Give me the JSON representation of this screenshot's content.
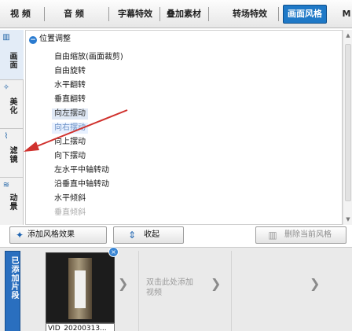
{
  "tabs": [
    {
      "label": "视 频"
    },
    {
      "label": "音 频"
    },
    {
      "label": "字幕特效"
    },
    {
      "label": "叠加素材"
    },
    {
      "label": "转场特效"
    },
    {
      "label": "画面风格"
    },
    {
      "label": "M"
    }
  ],
  "categories": [
    {
      "icon": "▥",
      "label": "画面"
    },
    {
      "icon": "✧",
      "label": "美化"
    },
    {
      "icon": "⌇",
      "label": "滤镜"
    },
    {
      "icon": "≋",
      "label": "动景"
    }
  ],
  "group": {
    "title": "位置调整",
    "collapse_symbol": "−"
  },
  "items": [
    "自由缩放(画面裁剪)",
    "自由旋转",
    "水平翻转",
    "垂直翻转",
    "向左摆动",
    "向右摆动",
    "向上摆动",
    "向下摆动",
    "左水平中轴转动",
    "沿垂直中轴转动",
    "水平倾斜",
    "垂直倾斜"
  ],
  "selected_item_index": 4,
  "buttons": {
    "add_style": "添加风格效果",
    "collapse": "收起",
    "delete_current": "删除当前风格"
  },
  "bottom": {
    "side_label": "已添加片段",
    "clip_caption": "VID_20200313...",
    "add_hint": "双击此处添加视频"
  },
  "colors": {
    "accent": "#1f79c7",
    "annotation_arrow": "#d0312d"
  }
}
